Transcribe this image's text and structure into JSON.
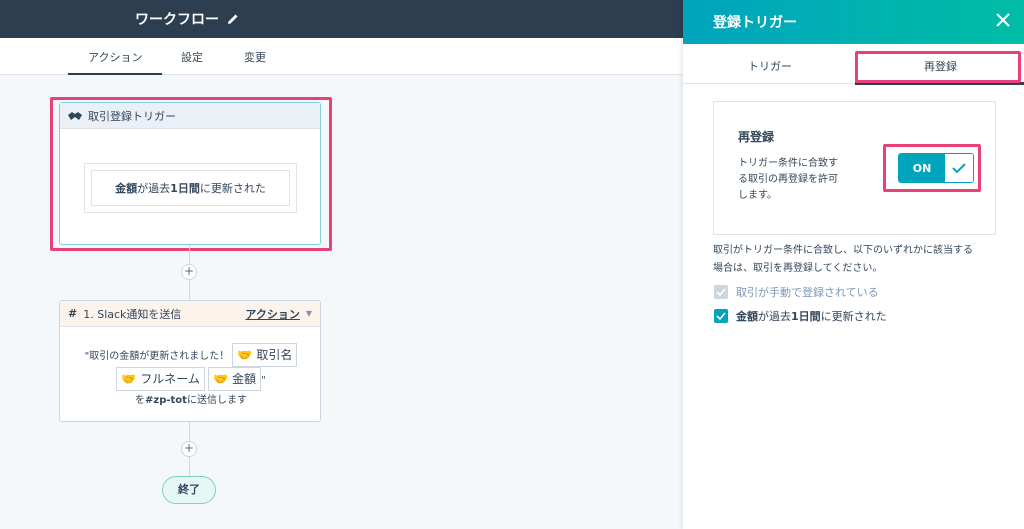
{
  "header": {
    "title": "ワークフロー"
  },
  "tabs": [
    "アクション",
    "設定",
    "変更"
  ],
  "trigger_card": {
    "title": "取引登録トリガー",
    "condition_bold": "金額",
    "condition_mid": "が過去",
    "condition_bold2": "1日間",
    "condition_end": "に更新された"
  },
  "action_card": {
    "title": "1. Slack通知を送信",
    "type_label": "アクション",
    "line1_prefix": "\"取引の金額が更新されました！",
    "token1": "取引名",
    "token2": "フルネーム",
    "token3": "金額",
    "line2_suffix": "\"",
    "line3_prefix": "を",
    "channel": "#zp-tot",
    "line3_suffix": "に送信します"
  },
  "end_label": "終了",
  "panel": {
    "title": "登録トリガー",
    "tabs": [
      "トリガー",
      "再登録"
    ],
    "section_title": "再登録",
    "section_desc": "トリガー条件に合致する取引の再登録を許可します。",
    "desc_lines": [
      "トリガー条件に合致す",
      "る取引の再登録を許可",
      "します。"
    ],
    "toggle_label": "ON",
    "note_line1": "取引がトリガー条件に合致し、以下のいずれかに該当する",
    "note_line2": "場合は、取引を再登録してください。",
    "option1": "取引が手動で登録されている",
    "option2_bold": "金額",
    "option2_mid": "が過去",
    "option2_bold2": "1日間",
    "option2_end": "に更新された"
  },
  "colors": {
    "highlight": "#e8417a",
    "accent": "#00a4bd",
    "header": "#2d3e50"
  }
}
